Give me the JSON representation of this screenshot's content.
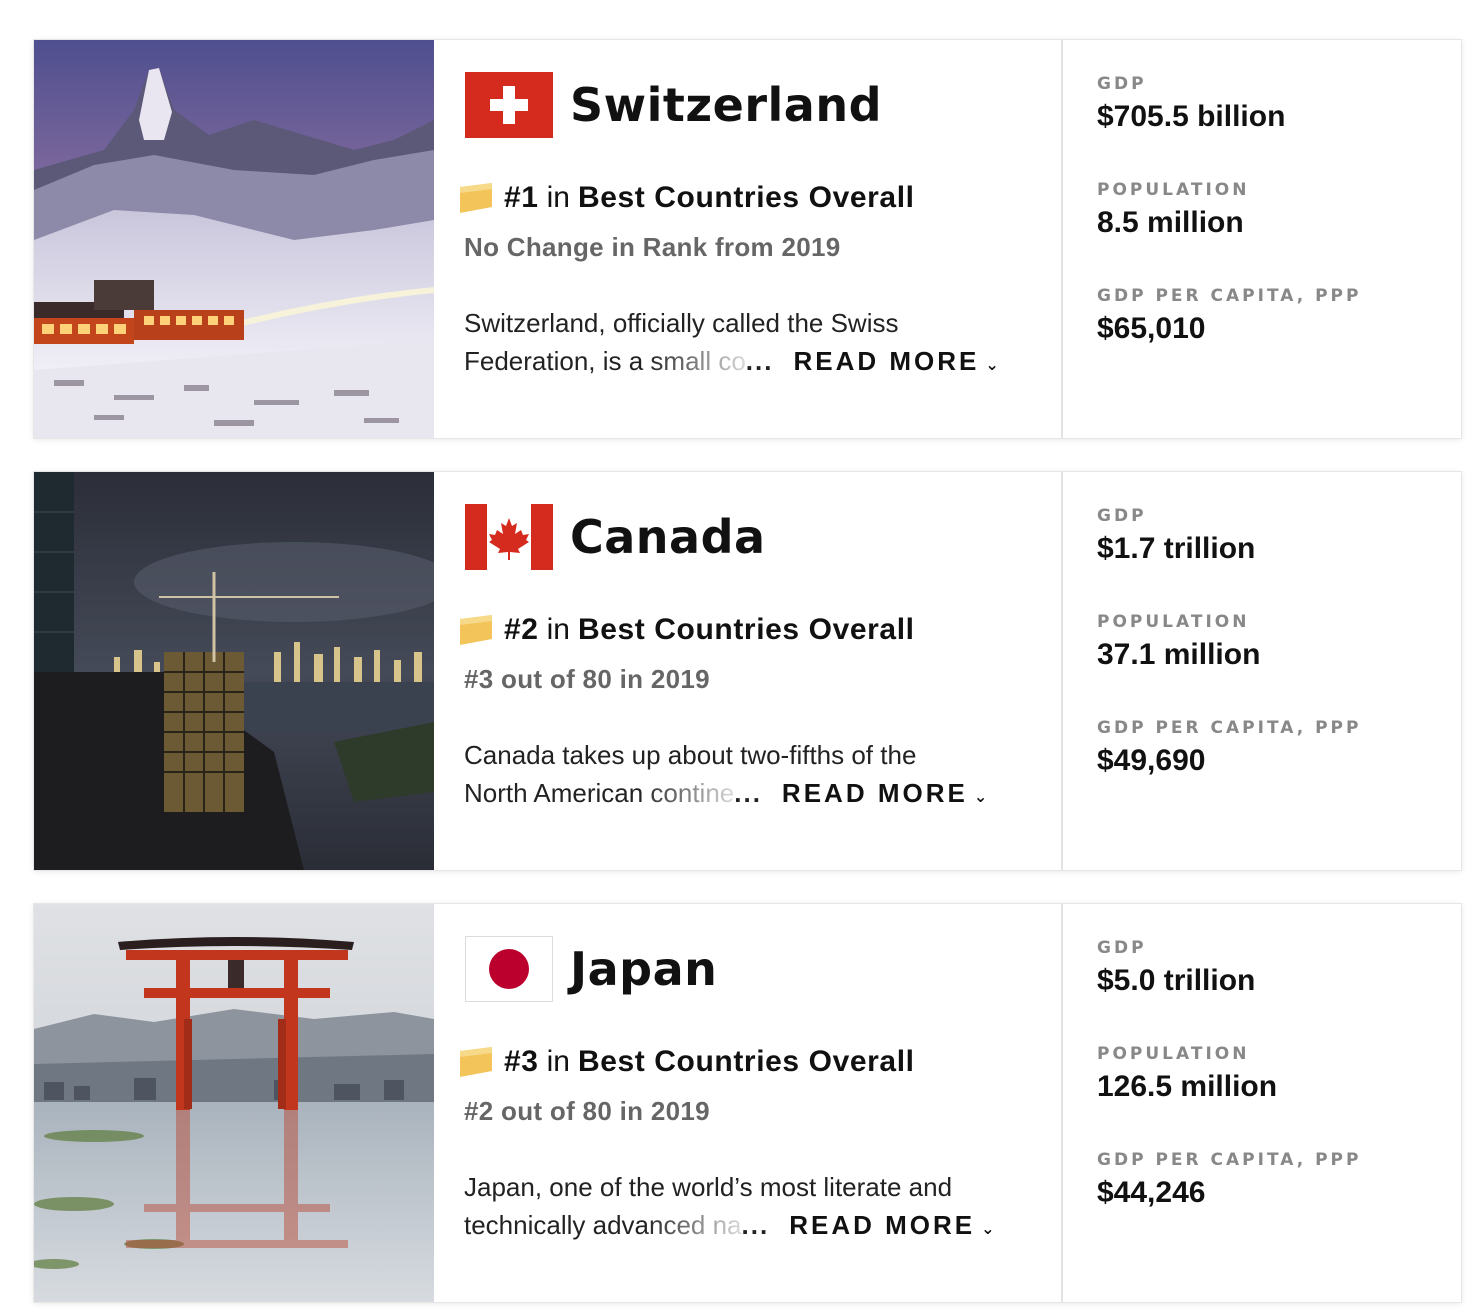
{
  "countries": [
    {
      "name": "Switzerland",
      "flag": "swiss-flag",
      "rank": "#1",
      "rank_in": "in",
      "rank_category": "Best Countries Overall",
      "rank_change": "No Change in Rank from 2019",
      "desc_line1": "Switzerland, officially called the Swiss",
      "desc_line2": "Federation, is a small co",
      "ellipsis": "...",
      "read_more": "READ MORE",
      "gdp_label": "GDP",
      "gdp": "$705.5 billion",
      "population_label": "POPULATION",
      "population": "8.5 million",
      "gdp_ppp_label": "GDP PER CAPITA, PPP",
      "gdp_ppp": "$65,010"
    },
    {
      "name": "Canada",
      "flag": "canada-flag",
      "rank": "#2",
      "rank_in": "in",
      "rank_category": "Best Countries Overall",
      "rank_change": "#3 out of 80 in 2019",
      "desc_line1": "Canada takes up about two-fifths of the",
      "desc_line2": "North American contine",
      "ellipsis": "...",
      "read_more": "READ MORE",
      "gdp_label": "GDP",
      "gdp": "$1.7 trillion",
      "population_label": "POPULATION",
      "population": "37.1 million",
      "gdp_ppp_label": "GDP PER CAPITA, PPP",
      "gdp_ppp": "$49,690"
    },
    {
      "name": "Japan",
      "flag": "japan-flag",
      "rank": "#3",
      "rank_in": "in",
      "rank_category": "Best Countries Overall",
      "rank_change": "#2 out of 80 in 2019",
      "desc_line1": "Japan, one of the world’s most literate and",
      "desc_line2": "technically advanced na",
      "ellipsis": "...",
      "read_more": "READ MORE",
      "gdp_label": "GDP",
      "gdp": "$5.0 trillion",
      "population_label": "POPULATION",
      "population": "126.5 million",
      "gdp_ppp_label": "GDP PER CAPITA, PPP",
      "gdp_ppp": "$44,246"
    }
  ],
  "colors": {
    "ribbon": "#f2c45a",
    "swiss_red": "#d52b1e",
    "canada_red": "#d52b1e",
    "japan_red": "#bc002d"
  }
}
